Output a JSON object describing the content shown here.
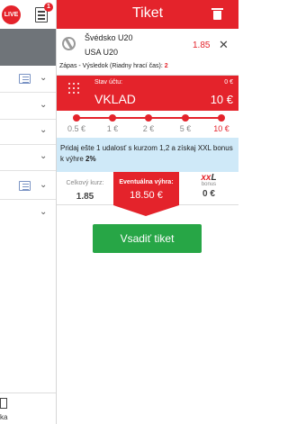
{
  "app": {
    "live_badge": "LIVE",
    "betslip_count": "1",
    "sidebar_bottom_label": "ka"
  },
  "ticket": {
    "title": "Tiket",
    "selection": {
      "home": "Švédsko U20",
      "away": "USA U20",
      "odds": "1.85",
      "market_label": "Zápas - Výsledok (Riadny hrací čas):",
      "market_value": "2"
    },
    "stake": {
      "balance_label": "Stav účtu:",
      "balance_value": "0 €",
      "stake_label": "VKLAD",
      "stake_value": "10 €"
    },
    "quick_amounts": [
      "0.5 €",
      "1 €",
      "2 €",
      "5 €",
      "10 €"
    ],
    "quick_amount_selected": 4,
    "promo_text": "Pridaj ešte 1 udalosť s kurzom 1,2 a získaj XXL bonus k výhre",
    "promo_value": "2%",
    "summary": {
      "total_odds_label": "Celkový kurz:",
      "total_odds_value": "1.85",
      "potential_win_label": "Eventuálna výhra:",
      "potential_win_value": "18.50 €",
      "xxl_logo_red": "xx",
      "xxl_logo_dark": "L",
      "bonus_label": "bonus",
      "bonus_value": "0 €"
    },
    "place_button": "Vsadiť tiket"
  },
  "colors": {
    "brand_red": "#e4232b",
    "button_green": "#27a646",
    "promo_blue": "#cfe9f8"
  }
}
